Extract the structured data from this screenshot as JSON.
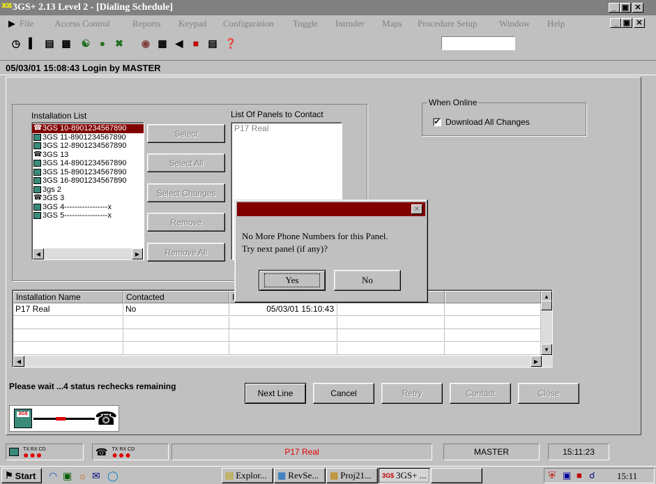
{
  "window": {
    "title": "3GS+ 2.13 Level 2 - [Dialing Schedule]",
    "app_logo": "3G$",
    "controls": [
      "_",
      "ő",
      "×"
    ]
  },
  "menu": {
    "items": [
      "File",
      "Access Control",
      "Reports",
      "Keypad",
      "Configuration",
      "Toggle",
      "Intruder",
      "Maps",
      "Procedure Setup",
      "Window",
      "Help"
    ]
  },
  "toolbar": {
    "search_value": ""
  },
  "login_status": "05/03/01 15:08:43 Login by  MASTER",
  "installation_list": {
    "label": "Installation List",
    "items": [
      {
        "name": "3GS 10-8901234567890",
        "icon": "phone-icon",
        "selected": true
      },
      {
        "name": "3GS 11-8901234567890",
        "icon": "panel-icon",
        "selected": false
      },
      {
        "name": "3GS 12-8901234567890",
        "icon": "panel-icon",
        "selected": false
      },
      {
        "name": "3GS 13",
        "icon": "phone-icon",
        "selected": false
      },
      {
        "name": "3GS 14-8901234567890",
        "icon": "panel-icon",
        "selected": false
      },
      {
        "name": "3GS 15-8901234567890",
        "icon": "panel-icon",
        "selected": false
      },
      {
        "name": "3GS 16-8901234567890",
        "icon": "panel-icon",
        "selected": false
      },
      {
        "name": "3gs 2",
        "icon": "panel-icon",
        "selected": false
      },
      {
        "name": "3GS 3",
        "icon": "phone-icon",
        "selected": false
      },
      {
        "name": "3GS 4-----------------x",
        "icon": "panel-icon",
        "selected": false
      },
      {
        "name": "3GS 5-----------------x",
        "icon": "panel-icon",
        "selected": false
      }
    ]
  },
  "buttons": {
    "select": "Select",
    "select_all": "Select All",
    "select_changes": "Select Changes",
    "remove": "Remove",
    "remove_all": "Remove All"
  },
  "panels_to_contact": {
    "label": "List Of Panels to Contact",
    "items": [
      "P17 Real"
    ]
  },
  "when_online": {
    "label": "When Online",
    "checkbox_label": "Download All Changes",
    "checked": true
  },
  "grid": {
    "columns": [
      "Installation Name",
      "Contacted",
      "I",
      "",
      ""
    ],
    "rows": [
      [
        "P17 Real",
        "No",
        "05/03/01 15:10:43",
        "",
        ""
      ]
    ]
  },
  "wait_message": "Please wait ...4 status rechecks remaining",
  "actions": {
    "next_line": "Next Line",
    "cancel": "Cancel",
    "retry": "Retry",
    "contact": "Contact",
    "close": "Close"
  },
  "dialog": {
    "message_line1": "No More Phone Numbers for this Panel.",
    "message_line2": "Try next panel (if any)?",
    "yes": "Yes",
    "no": "No",
    "close": "×"
  },
  "statusbar": {
    "signal1": "TX RX CD",
    "signal2": "TX RX CD",
    "panel": "P17 Real",
    "user": "MASTER",
    "time": "15:11:23"
  },
  "taskbar": {
    "start": "Start",
    "tasks": [
      "Explor...",
      "RevSe...",
      "Proj21...",
      "3GS+ ..."
    ],
    "clock": "15:11"
  },
  "colors": {
    "selection": "#800000",
    "titlebar_inactive": "#808080",
    "status_red": "#e00000"
  }
}
